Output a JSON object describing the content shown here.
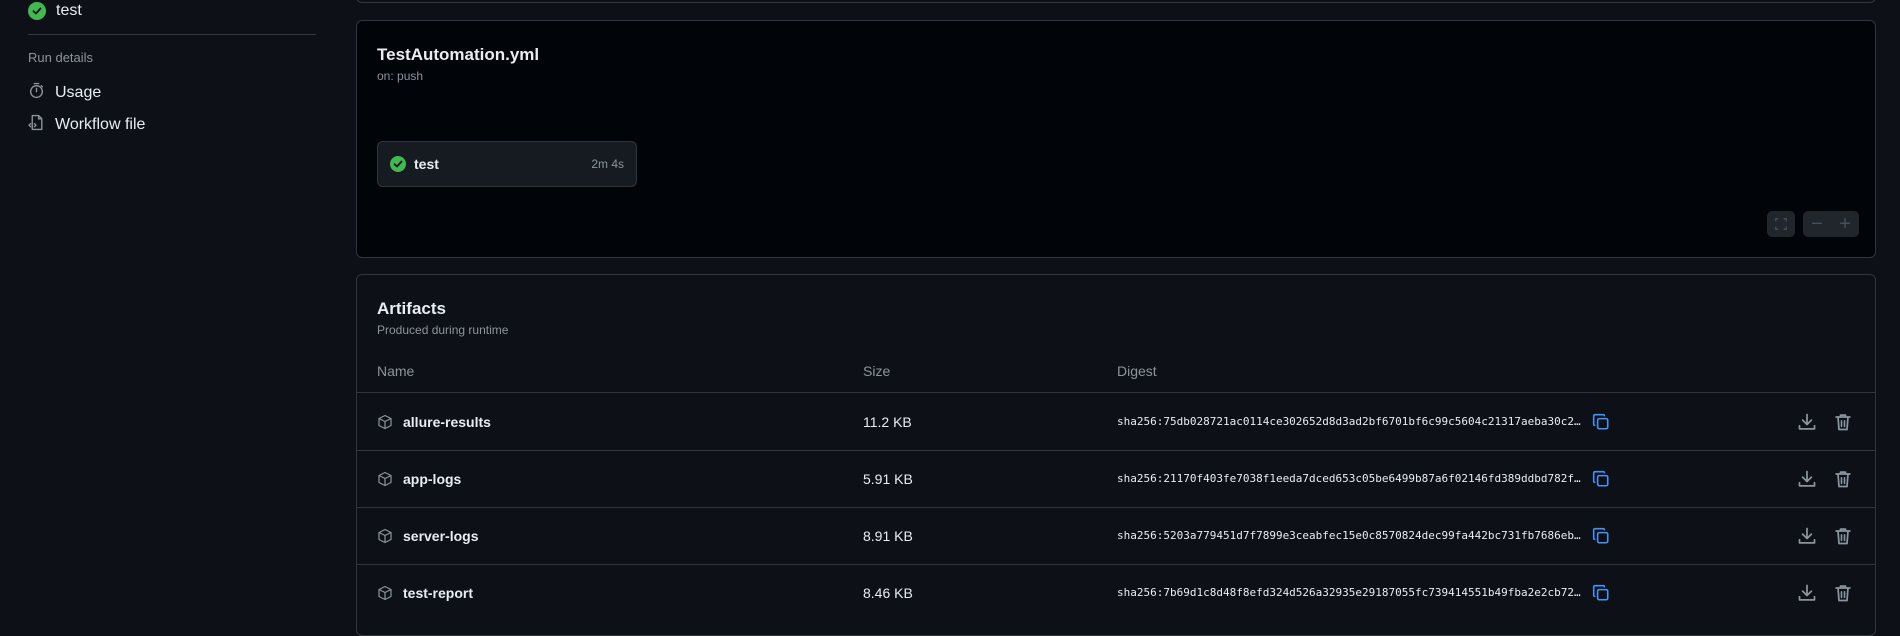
{
  "sidebar": {
    "job": {
      "label": "test",
      "status": "success"
    },
    "section_title": "Run details",
    "links": [
      {
        "label": "Usage",
        "icon": "stopwatch-icon"
      },
      {
        "label": "Workflow file",
        "icon": "file-code-icon"
      }
    ]
  },
  "graph": {
    "title": "TestAutomation.yml",
    "trigger": "on: push",
    "job": {
      "label": "test",
      "duration": "2m 4s",
      "status": "success"
    },
    "controls": [
      "fullscreen-icon",
      "zoom-out-icon",
      "zoom-in-icon"
    ]
  },
  "artifacts": {
    "title": "Artifacts",
    "subtitle": "Produced during runtime",
    "columns": {
      "name": "Name",
      "size": "Size",
      "digest": "Digest"
    },
    "rows": [
      {
        "name": "allure-results",
        "size": "11.2 KB",
        "digest": "sha256:75db028721ac0114ce302652d8d3ad2bf6701bf6c99c5604c21317aeba30c2…"
      },
      {
        "name": "app-logs",
        "size": "5.91 KB",
        "digest": "sha256:21170f403fe7038f1eeda7dced653c05be6499b87a6f02146fd389ddbd782f…"
      },
      {
        "name": "server-logs",
        "size": "8.91 KB",
        "digest": "sha256:5203a779451d7f7899e3ceabfec15e0c8570824dec99fa442bc731fb7686eb…"
      },
      {
        "name": "test-report",
        "size": "8.46 KB",
        "digest": "sha256:7b69d1c8d48f8efd324d526a32935e29187055fc739414551b49fba2e2cb72…"
      }
    ]
  },
  "colors": {
    "background": "#0d1117",
    "success": "#3fb950",
    "border": "#30363d",
    "muted": "#8b949e",
    "accent": "#4493f8"
  }
}
